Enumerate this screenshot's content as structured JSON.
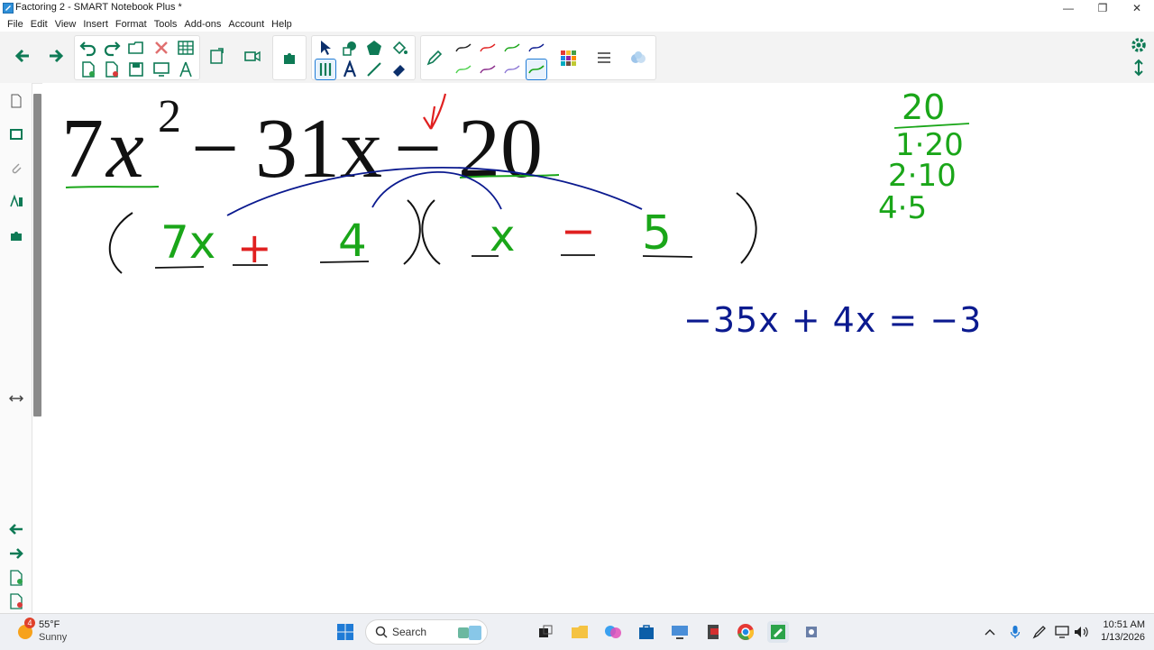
{
  "window": {
    "title": "Factoring 2 - SMART Notebook Plus *",
    "controls": {
      "minimize": "—",
      "maximize": "❐",
      "close": "✕"
    }
  },
  "menu": [
    "File",
    "Edit",
    "View",
    "Insert",
    "Format",
    "Tools",
    "Add-ons",
    "Account",
    "Help"
  ],
  "board": {
    "expression": {
      "coef": "7",
      "var": "x",
      "exp": "2",
      "op1": "−",
      "mid": "31x",
      "op2": "−",
      "last": "20"
    },
    "factors": {
      "open1": "(",
      "t1": "7x",
      "op1": "+",
      "t2": "4",
      "closeopen": ")(",
      "t3": "x",
      "op2": "−",
      "t4": "5",
      "close2": ")"
    },
    "factor_list": {
      "header": "20",
      "pairs": [
        "1·20",
        "2·10",
        "4·5"
      ]
    },
    "check": "−35x + 4x = −3",
    "colors": {
      "ink_green": "#1aa619",
      "ink_blue": "#0b1a8f",
      "ink_red": "#e02020",
      "ink_black": "#111111"
    }
  },
  "taskbar": {
    "weather": {
      "temp": "55°F",
      "condition": "Sunny",
      "badge": "4"
    },
    "search_placeholder": "Search",
    "time": "10:51 AM",
    "date": "1/13/2026"
  }
}
